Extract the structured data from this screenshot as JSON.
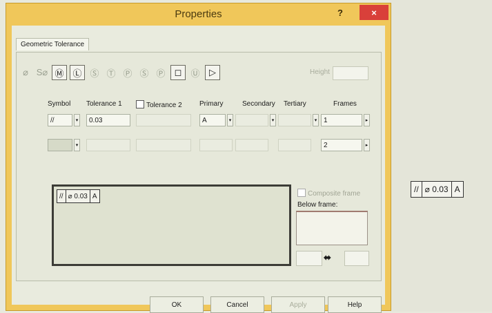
{
  "dialog": {
    "title": "Properties",
    "help_glyph": "?",
    "close_glyph": "×"
  },
  "tab": {
    "label": "Geometric Tolerance"
  },
  "symbols": [
    {
      "icon": "diameter-icon",
      "glyph": "⌀"
    },
    {
      "icon": "sdiameter-icon",
      "glyph": "S⌀"
    },
    {
      "icon": "mmc-icon",
      "glyph": "Ⓜ"
    },
    {
      "icon": "lmc-icon",
      "glyph": "Ⓛ"
    },
    {
      "icon": "symbol-icon",
      "glyph": "Ⓢ"
    },
    {
      "icon": "symbol-icon",
      "glyph": "Ⓣ"
    },
    {
      "icon": "symbol-icon",
      "glyph": "Ⓟ"
    },
    {
      "icon": "symbol-icon",
      "glyph": "Ⓢ"
    },
    {
      "icon": "symbol-icon",
      "glyph": "Ⓟ"
    },
    {
      "icon": "square-box-icon",
      "glyph": "◻"
    },
    {
      "icon": "symbol-icon",
      "glyph": "Ⓤ"
    },
    {
      "icon": "triangle-arrow-icon",
      "glyph": "▷"
    }
  ],
  "height_label": "Height",
  "columns": {
    "symbol": "Symbol",
    "tolerance1": "Tolerance 1",
    "tolerance2": "Tolerance 2",
    "primary": "Primary",
    "secondary": "Secondary",
    "tertiary": "Tertiary",
    "frames": "Frames"
  },
  "row1": {
    "symbol": "//",
    "tolerance1": "0.03",
    "primary": "A",
    "frames": "1"
  },
  "row2": {
    "frames": "2"
  },
  "preview": {
    "symbol": "//",
    "diameter": "⌀",
    "value": "0.03",
    "datum": "A"
  },
  "composite_label": "Composite frame",
  "below_frame_label": "Below frame:",
  "gap_arrow": "⬌",
  "buttons": {
    "ok": "OK",
    "cancel": "Cancel",
    "apply": "Apply",
    "help": "Help"
  },
  "right_preview": {
    "symbol": "//",
    "diameter": "⌀",
    "value": "0.03",
    "datum": "A"
  }
}
